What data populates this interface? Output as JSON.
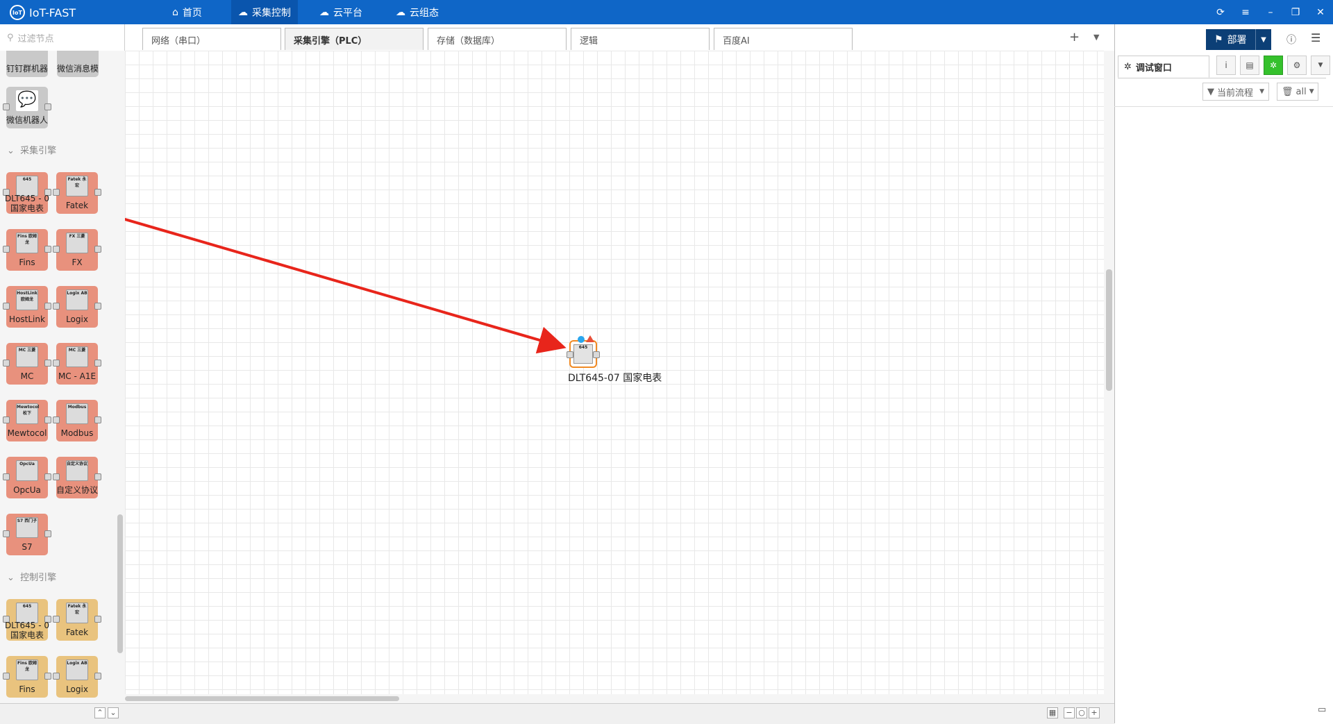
{
  "app": {
    "title": "IoT-FAST",
    "logo_text": "IoT",
    "nav": [
      "首页",
      "采集控制",
      "云平台",
      "云组态"
    ]
  },
  "filter": {
    "placeholder": "过滤节点"
  },
  "tabs": [
    "网络（串口）",
    "采集引擎（PLC）",
    "存储（数据库）",
    "逻辑",
    "百度AI"
  ],
  "palette": {
    "top_nodes": [
      "钉钉群机器",
      "微信消息模"
    ],
    "wechat_robot": "微信机器人",
    "section_collect": "采集引擎",
    "collect_nodes": [
      {
        "label": "DLT645 - 0\n国家电表",
        "icon": "645"
      },
      {
        "label": "Fatek",
        "icon": "Fatek 永宏"
      },
      {
        "label": "Fins",
        "icon": "Fins 欧姆龙"
      },
      {
        "label": "FX",
        "icon": "FX 三菱"
      },
      {
        "label": "HostLink",
        "icon": "HostLink 欧姆龙"
      },
      {
        "label": "Logix",
        "icon": "Logix AB"
      },
      {
        "label": "MC",
        "icon": "MC 三菱"
      },
      {
        "label": "MC - A1E",
        "icon": "MC 三菱"
      },
      {
        "label": "Mewtocol",
        "icon": "Mewtocol 松下"
      },
      {
        "label": "Modbus",
        "icon": "Modbus"
      },
      {
        "label": "OpcUa",
        "icon": "OpcUa"
      },
      {
        "label": "自定义协议",
        "icon": "自定义协议"
      },
      {
        "label": "S7",
        "icon": "S7 西门子"
      }
    ],
    "section_control": "控制引擎",
    "control_nodes": [
      {
        "label": "DLT645 - 0\n国家电表",
        "icon": "645"
      },
      {
        "label": "Fatek",
        "icon": "Fatek 永宏"
      },
      {
        "label": "Fins",
        "icon": "Fins 欧姆龙"
      },
      {
        "label": "Logix",
        "icon": "Logix AB"
      }
    ]
  },
  "flow": {
    "node_label": "DLT645-07 国家电表",
    "node_icon": "645"
  },
  "right_panel": {
    "deploy_label": "部署",
    "debug_tab": "调试窗口",
    "filter_flow": "当前流程",
    "filter_all": "all"
  },
  "colors": {
    "topbar": "#0f66c7",
    "collect_node": "#e8917d",
    "control_node": "#e9c37e",
    "arrow": "#e8251b",
    "deploy": "#0c3f76",
    "debug_active": "#35c12c"
  }
}
